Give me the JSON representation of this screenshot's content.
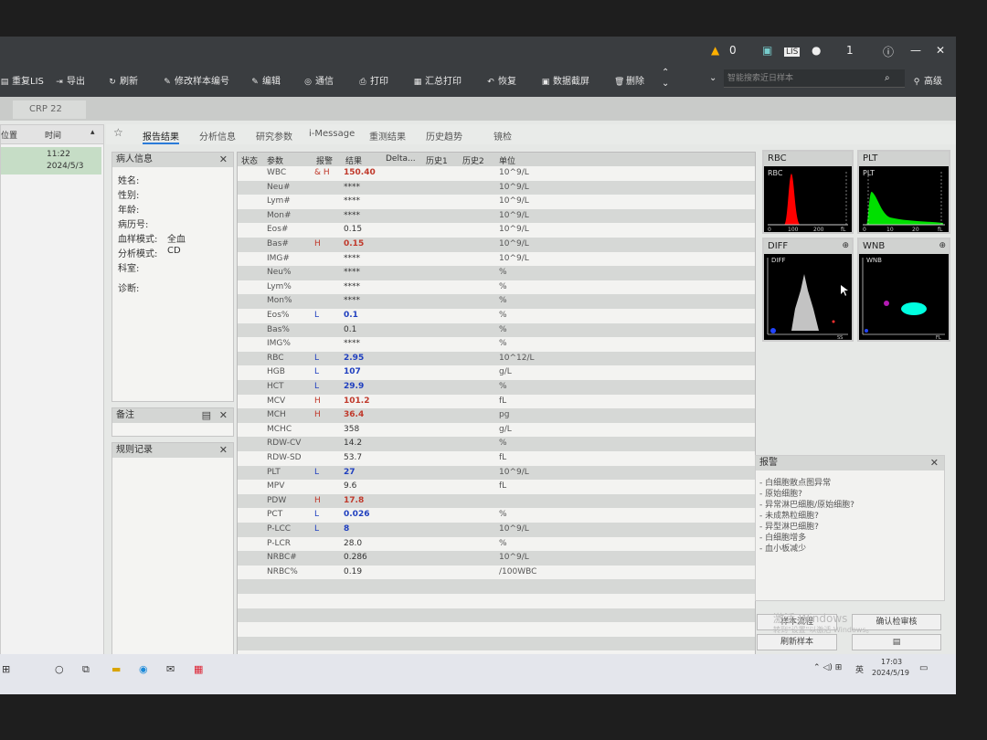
{
  "titlebar": {
    "warning_count": "0",
    "lis_label": "LIS",
    "user_count": "1",
    "icons": [
      "warning-icon",
      "monitor-icon",
      "user-icon",
      "info-icon",
      "minimize-icon",
      "close-icon"
    ]
  },
  "toolbar": {
    "items": [
      "重复LIS",
      "导出",
      "刷新",
      "修改样本编号",
      "编辑",
      "通信",
      "打印",
      "汇总打印",
      "恢复",
      "数据截屏",
      "删除"
    ],
    "search_placeholder": "智能搜索近日样本",
    "advanced_label": "高级"
  },
  "crp_tab": "CRP  22",
  "left_panel": {
    "col1": "位置",
    "col2": "时间",
    "row_time": "11:22",
    "row_date": "2024/5/3"
  },
  "tabs": [
    "报告结果",
    "分析信息",
    "研究参数",
    "i-Message",
    "重测结果",
    "历史趋势",
    "镜检"
  ],
  "patient_info": {
    "title": "病人信息",
    "fields": [
      {
        "label": "姓名:",
        "value": ""
      },
      {
        "label": "性别:",
        "value": ""
      },
      {
        "label": "年龄:",
        "value": ""
      },
      {
        "label": "病历号:",
        "value": ""
      },
      {
        "label": "血样模式:",
        "value": "全血"
      },
      {
        "label": "分析模式:",
        "value": "CD"
      },
      {
        "label": "科室:",
        "value": ""
      },
      {
        "label": "诊断:",
        "value": ""
      }
    ]
  },
  "notes_title": "备注",
  "rules_title": "规则记录",
  "table": {
    "headers": [
      "状态",
      "参数",
      "报警",
      "结果",
      "Delta...",
      "历史1",
      "历史2",
      "单位"
    ],
    "rows": [
      {
        "param": "WBC",
        "alarm": "& H",
        "result": "150.40",
        "unit": "10^9/L",
        "flag": "H"
      },
      {
        "param": "Neu#",
        "alarm": "",
        "result": "****",
        "unit": "10^9/L",
        "flag": ""
      },
      {
        "param": "Lym#",
        "alarm": "",
        "result": "****",
        "unit": "10^9/L",
        "flag": ""
      },
      {
        "param": "Mon#",
        "alarm": "",
        "result": "****",
        "unit": "10^9/L",
        "flag": ""
      },
      {
        "param": "Eos#",
        "alarm": "",
        "result": "0.15",
        "unit": "10^9/L",
        "flag": ""
      },
      {
        "param": "Bas#",
        "alarm": "H",
        "result": "0.15",
        "unit": "10^9/L",
        "flag": "H"
      },
      {
        "param": "IMG#",
        "alarm": "",
        "result": "****",
        "unit": "10^9/L",
        "flag": ""
      },
      {
        "param": "Neu%",
        "alarm": "",
        "result": "****",
        "unit": "%",
        "flag": ""
      },
      {
        "param": "Lym%",
        "alarm": "",
        "result": "****",
        "unit": "%",
        "flag": ""
      },
      {
        "param": "Mon%",
        "alarm": "",
        "result": "****",
        "unit": "%",
        "flag": ""
      },
      {
        "param": "Eos%",
        "alarm": "L",
        "result": "0.1",
        "unit": "%",
        "flag": "L"
      },
      {
        "param": "Bas%",
        "alarm": "",
        "result": "0.1",
        "unit": "%",
        "flag": ""
      },
      {
        "param": "IMG%",
        "alarm": "",
        "result": "****",
        "unit": "%",
        "flag": ""
      },
      {
        "param": "RBC",
        "alarm": "L",
        "result": "2.95",
        "unit": "10^12/L",
        "flag": "L"
      },
      {
        "param": "HGB",
        "alarm": "L",
        "result": "107",
        "unit": "g/L",
        "flag": "L"
      },
      {
        "param": "HCT",
        "alarm": "L",
        "result": "29.9",
        "unit": "%",
        "flag": "L"
      },
      {
        "param": "MCV",
        "alarm": "H",
        "result": "101.2",
        "unit": "fL",
        "flag": "H"
      },
      {
        "param": "MCH",
        "alarm": "H",
        "result": "36.4",
        "unit": "pg",
        "flag": "H"
      },
      {
        "param": "MCHC",
        "alarm": "",
        "result": "358",
        "unit": "g/L",
        "flag": ""
      },
      {
        "param": "RDW-CV",
        "alarm": "",
        "result": "14.2",
        "unit": "%",
        "flag": ""
      },
      {
        "param": "RDW-SD",
        "alarm": "",
        "result": "53.7",
        "unit": "fL",
        "flag": ""
      },
      {
        "param": "PLT",
        "alarm": "L",
        "result": "27",
        "unit": "10^9/L",
        "flag": "L"
      },
      {
        "param": "MPV",
        "alarm": "",
        "result": "9.6",
        "unit": "fL",
        "flag": ""
      },
      {
        "param": "PDW",
        "alarm": "H",
        "result": "17.8",
        "unit": "",
        "flag": "H"
      },
      {
        "param": "PCT",
        "alarm": "L",
        "result": "0.026",
        "unit": "%",
        "flag": "L"
      },
      {
        "param": "P-LCC",
        "alarm": "L",
        "result": "8",
        "unit": "10^9/L",
        "flag": "L"
      },
      {
        "param": "P-LCR",
        "alarm": "",
        "result": "28.0",
        "unit": "%",
        "flag": ""
      },
      {
        "param": "NRBC#",
        "alarm": "",
        "result": "0.286",
        "unit": "10^9/L",
        "flag": ""
      },
      {
        "param": "NRBC%",
        "alarm": "",
        "result": "0.19",
        "unit": "/100WBC",
        "flag": ""
      }
    ]
  },
  "histograms": {
    "rbc": {
      "title": "RBC",
      "label": "RBC",
      "ticks": [
        "0",
        "100",
        "200",
        "fL"
      ]
    },
    "plt": {
      "title": "PLT",
      "label": "PLT",
      "ticks": [
        "0",
        "10",
        "20",
        "fL"
      ]
    },
    "diff": {
      "title": "DIFF",
      "label": "DIFF",
      "axis": "SS"
    },
    "wnb": {
      "title": "WNB",
      "label": "WNB",
      "axis": "FL"
    }
  },
  "alarm": {
    "title": "报警",
    "items": [
      "- 白细胞散点图异常",
      "- 原始细胞?",
      "- 异常淋巴细胞/原始细胞?",
      "- 未成熟粒细胞?",
      "- 异型淋巴细胞?",
      "- 白细胞增多",
      "- 血小板减少"
    ]
  },
  "buttons": {
    "sample_flow": "样本流程",
    "confirm_review": "确认检审核",
    "refresh_sample": "刷新样本",
    "watermark_1": "激活 Windows",
    "watermark_2": "转到\"设置\"以激活 Windows。"
  },
  "taskbar": {
    "time": "17:03",
    "date": "2024/5/19",
    "lang": "英",
    "icons": [
      "start-icon",
      "search-icon",
      "taskview-icon",
      "explorer-icon",
      "edge-icon",
      "mail-icon",
      "app-icon"
    ]
  },
  "colors": {
    "high": "#c0392b",
    "low": "#1f3fbf",
    "plot_red": "#ff0000",
    "plot_green": "#00e000",
    "plot_cyan": "#00ffe0"
  }
}
